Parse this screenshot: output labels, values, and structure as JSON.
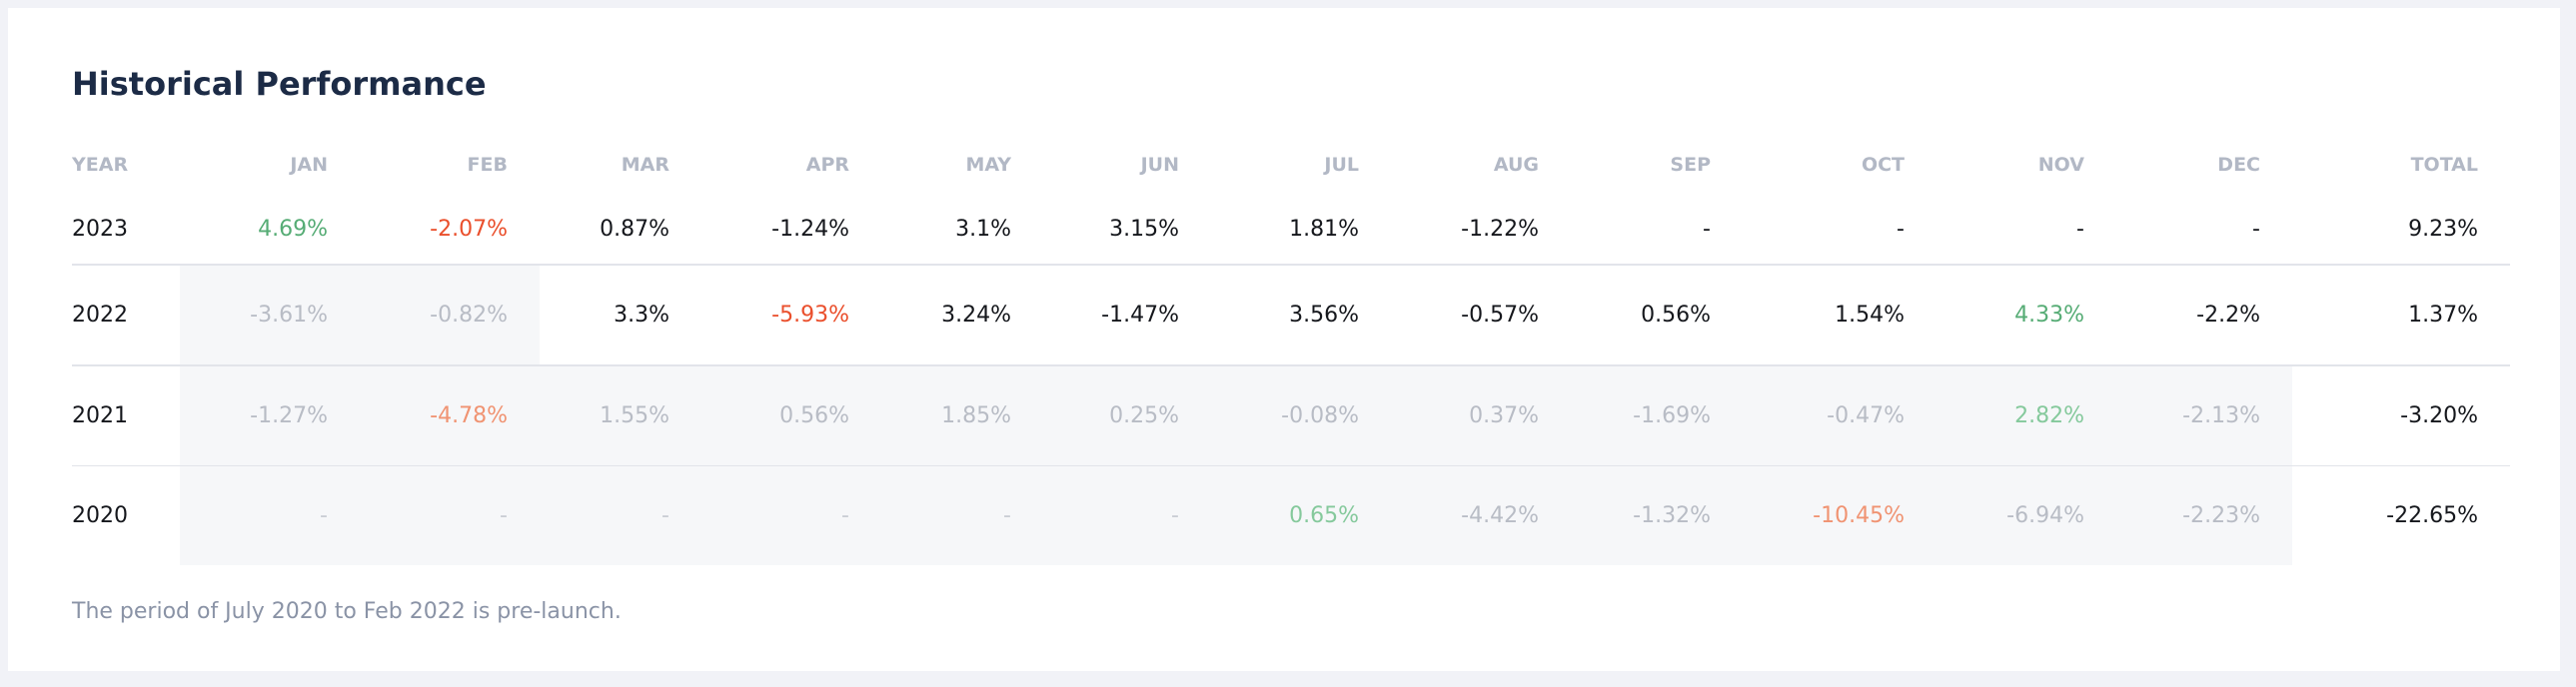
{
  "title": "Historical Performance",
  "columns": [
    "YEAR",
    "JAN",
    "FEB",
    "MAR",
    "APR",
    "MAY",
    "JUN",
    "JUL",
    "AUG",
    "SEP",
    "OCT",
    "NOV",
    "DEC",
    "TOTAL"
  ],
  "rows": [
    {
      "year": "2023",
      "cells": [
        {
          "v": "4.69%",
          "t": "pos"
        },
        {
          "v": "-2.07%",
          "t": "neg"
        },
        {
          "v": "0.87%",
          "t": ""
        },
        {
          "v": "-1.24%",
          "t": ""
        },
        {
          "v": "3.1%",
          "t": ""
        },
        {
          "v": "3.15%",
          "t": ""
        },
        {
          "v": "1.81%",
          "t": ""
        },
        {
          "v": "-1.22%",
          "t": ""
        },
        {
          "v": "-",
          "t": ""
        },
        {
          "v": "-",
          "t": ""
        },
        {
          "v": "-",
          "t": ""
        },
        {
          "v": "-",
          "t": ""
        }
      ],
      "total": "9.23%"
    },
    {
      "year": "2022",
      "cells": [
        {
          "v": "-3.61%",
          "t": "pre"
        },
        {
          "v": "-0.82%",
          "t": "pre"
        },
        {
          "v": "3.3%",
          "t": ""
        },
        {
          "v": "-5.93%",
          "t": "neg"
        },
        {
          "v": "3.24%",
          "t": ""
        },
        {
          "v": "-1.47%",
          "t": ""
        },
        {
          "v": "3.56%",
          "t": ""
        },
        {
          "v": "-0.57%",
          "t": ""
        },
        {
          "v": "0.56%",
          "t": ""
        },
        {
          "v": "1.54%",
          "t": ""
        },
        {
          "v": "4.33%",
          "t": "pos"
        },
        {
          "v": "-2.2%",
          "t": ""
        }
      ],
      "total": "1.37%"
    },
    {
      "year": "2021",
      "cells": [
        {
          "v": "-1.27%",
          "t": "pre"
        },
        {
          "v": "-4.78%",
          "t": "pre neg"
        },
        {
          "v": "1.55%",
          "t": "pre"
        },
        {
          "v": "0.56%",
          "t": "pre"
        },
        {
          "v": "1.85%",
          "t": "pre"
        },
        {
          "v": "0.25%",
          "t": "pre"
        },
        {
          "v": "-0.08%",
          "t": "pre"
        },
        {
          "v": "0.37%",
          "t": "pre"
        },
        {
          "v": "-1.69%",
          "t": "pre"
        },
        {
          "v": "-0.47%",
          "t": "pre"
        },
        {
          "v": "2.82%",
          "t": "pre pos"
        },
        {
          "v": "-2.13%",
          "t": "pre"
        }
      ],
      "total": "-3.20%"
    },
    {
      "year": "2020",
      "cells": [
        {
          "v": "-",
          "t": "pre dash"
        },
        {
          "v": "-",
          "t": "pre dash"
        },
        {
          "v": "-",
          "t": "pre dash"
        },
        {
          "v": "-",
          "t": "pre dash"
        },
        {
          "v": "-",
          "t": "pre dash"
        },
        {
          "v": "-",
          "t": "pre dash"
        },
        {
          "v": "0.65%",
          "t": "pre pos"
        },
        {
          "v": "-4.42%",
          "t": "pre"
        },
        {
          "v": "-1.32%",
          "t": "pre"
        },
        {
          "v": "-10.45%",
          "t": "pre neg"
        },
        {
          "v": "-6.94%",
          "t": "pre"
        },
        {
          "v": "-2.23%",
          "t": "pre"
        }
      ],
      "total": "-22.65%"
    }
  ],
  "note": "The period of July 2020 to Feb 2022 is pre-launch.",
  "colors": {
    "positive": "#56ac75",
    "negative": "#ea4f2c",
    "pre_launch_bg": "#f6f7f9",
    "title": "#1c2b46"
  }
}
